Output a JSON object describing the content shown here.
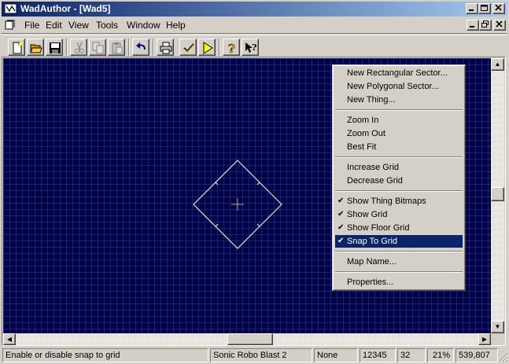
{
  "window": {
    "title": "WadAuthor - [Wad5]"
  },
  "menubar": {
    "items": [
      "File",
      "Edit",
      "View",
      "Tools",
      "Window",
      "Help"
    ]
  },
  "toolbar": {
    "buttons": [
      "new-icon",
      "open-icon",
      "save-icon",
      "cut-icon",
      "copy-icon",
      "paste-icon",
      "undo-icon",
      "print-icon",
      "check-icon",
      "run-icon",
      "help-icon",
      "context-help-icon"
    ]
  },
  "context_menu": {
    "items": [
      {
        "label": "New Rectangular Sector...",
        "checked": false
      },
      {
        "label": "New Polygonal Sector...",
        "checked": false
      },
      {
        "label": "New Thing...",
        "checked": false
      },
      {
        "label": "Zoom In",
        "checked": false
      },
      {
        "label": "Zoom Out",
        "checked": false
      },
      {
        "label": "Best Fit",
        "checked": false
      },
      {
        "label": "Increase Grid",
        "checked": false
      },
      {
        "label": "Decrease Grid",
        "checked": false
      },
      {
        "label": "Show Thing Bitmaps",
        "checked": true
      },
      {
        "label": "Show Grid",
        "checked": true
      },
      {
        "label": "Show Floor Grid",
        "checked": true
      },
      {
        "label": "Snap To Grid",
        "checked": true,
        "highlighted": true
      },
      {
        "label": "Map Name...",
        "checked": false
      },
      {
        "label": "Properties...",
        "checked": false
      }
    ]
  },
  "statusbar": {
    "message": "Enable or disable snap to grid",
    "game": "Sonic Robo Blast 2",
    "mode": "None",
    "value1": "12345",
    "grid": "32",
    "zoom": "21%",
    "coords": "539,807"
  },
  "colors": {
    "map_background": "#000040",
    "grid_line": "#0a2a8a",
    "highlight": "#0a246a",
    "title_gradient_start": "#0a246a",
    "title_gradient_end": "#a6caf0"
  }
}
